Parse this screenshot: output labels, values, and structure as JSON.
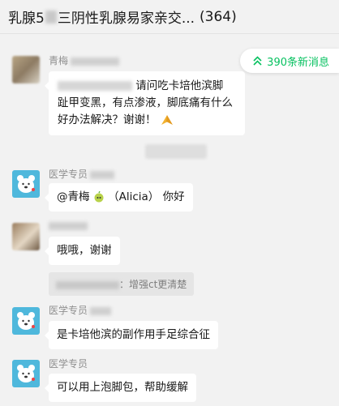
{
  "header": {
    "title_prefix": "乳腺5",
    "title_suffix": "三阴性乳腺易家亲交...",
    "member_count": "(364)"
  },
  "unread": {
    "label": "390条新消息",
    "color": "#07c160"
  },
  "messages": [
    {
      "sender": "青梅",
      "text_line1_tail": "请问吃卡培他滨脚",
      "text_line2": "趾甲变黑，有点渗液，脚底痛有什么",
      "text_line3": "好办法解决？谢谢！",
      "emoji": "pray-emoji"
    },
    {
      "sender": "医学专员",
      "text_mention": "@青梅",
      "text_rest": "（Alicia） 你好"
    },
    {
      "sender": "",
      "text": "哦哦，谢谢",
      "quote": "：增强ct更清楚"
    },
    {
      "sender": "医学专员",
      "text": "是卡培他滨的副作用手足综合征"
    },
    {
      "sender": "医学专员",
      "text": "可以用上泡脚包，帮助缓解"
    }
  ]
}
